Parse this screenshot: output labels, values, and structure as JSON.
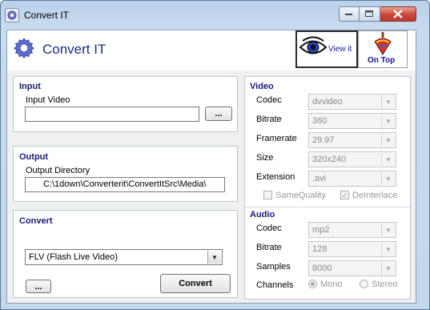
{
  "window": {
    "title": "Convert IT"
  },
  "header": {
    "app_title": "Convert IT",
    "view_label": "View it",
    "on_top_label": "On Top"
  },
  "input": {
    "title": "Input",
    "video_label": "Input Video",
    "video_value": "",
    "browse_label": "..."
  },
  "output": {
    "title": "Output",
    "dir_label": "Output Directory",
    "dir_value": "C:\\1down\\Converterit\\ConvertItSrc\\Media\\"
  },
  "convert": {
    "title": "Convert",
    "format_value": "FLV (Flash Live Video)",
    "more_label": "...",
    "convert_label": "Convert"
  },
  "video": {
    "title": "Video",
    "codec_label": "Codec",
    "codec_value": "dvvideo",
    "bitrate_label": "Bitrate",
    "bitrate_value": "360",
    "framerate_label": "Framerate",
    "framerate_value": "29.97",
    "size_label": "Size",
    "size_value": "320x240",
    "extension_label": "Extension",
    "extension_value": ".avi",
    "same_quality_label": "SameQuality",
    "same_quality_checked": false,
    "deinterlace_label": "DeInterlace",
    "deinterlace_checked": true
  },
  "audio": {
    "title": "Audio",
    "codec_label": "Codec",
    "codec_value": "mp2",
    "bitrate_label": "Bitrate",
    "bitrate_value": "128",
    "samples_label": "Samples",
    "samples_value": "8000",
    "channels_label": "Channels",
    "mono_label": "Mono",
    "stereo_label": "Stereo",
    "channels_selected": "Mono"
  },
  "colors": {
    "accent": "#1a1a7a",
    "title_blue": "#1a2f7a",
    "close_red": "#c9463a"
  },
  "icons": {
    "app": "gear-icon",
    "view": "eye-icon",
    "on_top": "spinning-top-icon"
  }
}
